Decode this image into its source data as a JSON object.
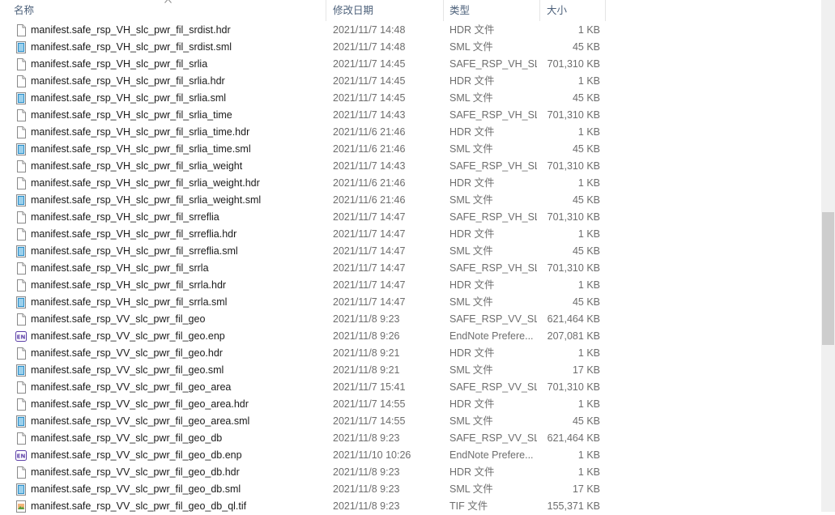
{
  "columns": {
    "name": "名称",
    "date": "修改日期",
    "type": "类型",
    "size": "大小"
  },
  "rows": [
    {
      "name": "manifest.safe_rsp_VH_slc_pwr_fil_srdist.hdr",
      "date": "2021/11/7 14:48",
      "type": "HDR 文件",
      "size": "1 KB",
      "icon": "document-icon"
    },
    {
      "name": "manifest.safe_rsp_VH_slc_pwr_fil_srdist.sml",
      "date": "2021/11/7 14:48",
      "type": "SML 文件",
      "size": "45 KB",
      "icon": "sml-file-icon"
    },
    {
      "name": "manifest.safe_rsp_VH_slc_pwr_fil_srlia",
      "date": "2021/11/7 14:45",
      "type": "SAFE_RSP_VH_SL...",
      "size": "701,310 KB",
      "icon": "document-icon"
    },
    {
      "name": "manifest.safe_rsp_VH_slc_pwr_fil_srlia.hdr",
      "date": "2021/11/7 14:45",
      "type": "HDR 文件",
      "size": "1 KB",
      "icon": "document-icon"
    },
    {
      "name": "manifest.safe_rsp_VH_slc_pwr_fil_srlia.sml",
      "date": "2021/11/7 14:45",
      "type": "SML 文件",
      "size": "45 KB",
      "icon": "sml-file-icon"
    },
    {
      "name": "manifest.safe_rsp_VH_slc_pwr_fil_srlia_time",
      "date": "2021/11/7 14:43",
      "type": "SAFE_RSP_VH_SL...",
      "size": "701,310 KB",
      "icon": "document-icon"
    },
    {
      "name": "manifest.safe_rsp_VH_slc_pwr_fil_srlia_time.hdr",
      "date": "2021/11/6 21:46",
      "type": "HDR 文件",
      "size": "1 KB",
      "icon": "document-icon"
    },
    {
      "name": "manifest.safe_rsp_VH_slc_pwr_fil_srlia_time.sml",
      "date": "2021/11/6 21:46",
      "type": "SML 文件",
      "size": "45 KB",
      "icon": "sml-file-icon"
    },
    {
      "name": "manifest.safe_rsp_VH_slc_pwr_fil_srlia_weight",
      "date": "2021/11/7 14:43",
      "type": "SAFE_RSP_VH_SL...",
      "size": "701,310 KB",
      "icon": "document-icon"
    },
    {
      "name": "manifest.safe_rsp_VH_slc_pwr_fil_srlia_weight.hdr",
      "date": "2021/11/6 21:46",
      "type": "HDR 文件",
      "size": "1 KB",
      "icon": "document-icon"
    },
    {
      "name": "manifest.safe_rsp_VH_slc_pwr_fil_srlia_weight.sml",
      "date": "2021/11/6 21:46",
      "type": "SML 文件",
      "size": "45 KB",
      "icon": "sml-file-icon"
    },
    {
      "name": "manifest.safe_rsp_VH_slc_pwr_fil_srreflia",
      "date": "2021/11/7 14:47",
      "type": "SAFE_RSP_VH_SL...",
      "size": "701,310 KB",
      "icon": "document-icon"
    },
    {
      "name": "manifest.safe_rsp_VH_slc_pwr_fil_srreflia.hdr",
      "date": "2021/11/7 14:47",
      "type": "HDR 文件",
      "size": "1 KB",
      "icon": "document-icon"
    },
    {
      "name": "manifest.safe_rsp_VH_slc_pwr_fil_srreflia.sml",
      "date": "2021/11/7 14:47",
      "type": "SML 文件",
      "size": "45 KB",
      "icon": "sml-file-icon"
    },
    {
      "name": "manifest.safe_rsp_VH_slc_pwr_fil_srrla",
      "date": "2021/11/7 14:47",
      "type": "SAFE_RSP_VH_SL...",
      "size": "701,310 KB",
      "icon": "document-icon"
    },
    {
      "name": "manifest.safe_rsp_VH_slc_pwr_fil_srrla.hdr",
      "date": "2021/11/7 14:47",
      "type": "HDR 文件",
      "size": "1 KB",
      "icon": "document-icon"
    },
    {
      "name": "manifest.safe_rsp_VH_slc_pwr_fil_srrla.sml",
      "date": "2021/11/7 14:47",
      "type": "SML 文件",
      "size": "45 KB",
      "icon": "sml-file-icon"
    },
    {
      "name": "manifest.safe_rsp_VV_slc_pwr_fil_geo",
      "date": "2021/11/8 9:23",
      "type": "SAFE_RSP_VV_SL...",
      "size": "621,464 KB",
      "icon": "document-icon"
    },
    {
      "name": "manifest.safe_rsp_VV_slc_pwr_fil_geo.enp",
      "date": "2021/11/8 9:26",
      "type": "EndNote Prefere...",
      "size": "207,081 KB",
      "icon": "endnote-icon"
    },
    {
      "name": "manifest.safe_rsp_VV_slc_pwr_fil_geo.hdr",
      "date": "2021/11/8 9:21",
      "type": "HDR 文件",
      "size": "1 KB",
      "icon": "document-icon"
    },
    {
      "name": "manifest.safe_rsp_VV_slc_pwr_fil_geo.sml",
      "date": "2021/11/8 9:21",
      "type": "SML 文件",
      "size": "17 KB",
      "icon": "sml-file-icon"
    },
    {
      "name": "manifest.safe_rsp_VV_slc_pwr_fil_geo_area",
      "date": "2021/11/7 15:41",
      "type": "SAFE_RSP_VV_SL...",
      "size": "701,310 KB",
      "icon": "document-icon"
    },
    {
      "name": "manifest.safe_rsp_VV_slc_pwr_fil_geo_area.hdr",
      "date": "2021/11/7 14:55",
      "type": "HDR 文件",
      "size": "1 KB",
      "icon": "document-icon"
    },
    {
      "name": "manifest.safe_rsp_VV_slc_pwr_fil_geo_area.sml",
      "date": "2021/11/7 14:55",
      "type": "SML 文件",
      "size": "45 KB",
      "icon": "sml-file-icon"
    },
    {
      "name": "manifest.safe_rsp_VV_slc_pwr_fil_geo_db",
      "date": "2021/11/8 9:23",
      "type": "SAFE_RSP_VV_SL...",
      "size": "621,464 KB",
      "icon": "document-icon"
    },
    {
      "name": "manifest.safe_rsp_VV_slc_pwr_fil_geo_db.enp",
      "date": "2021/11/10 10:26",
      "type": "EndNote Prefere...",
      "size": "1 KB",
      "icon": "endnote-icon"
    },
    {
      "name": "manifest.safe_rsp_VV_slc_pwr_fil_geo_db.hdr",
      "date": "2021/11/8 9:23",
      "type": "HDR 文件",
      "size": "1 KB",
      "icon": "document-icon"
    },
    {
      "name": "manifest.safe_rsp_VV_slc_pwr_fil_geo_db.sml",
      "date": "2021/11/8 9:23",
      "type": "SML 文件",
      "size": "17 KB",
      "icon": "sml-file-icon"
    },
    {
      "name": "manifest.safe_rsp_VV_slc_pwr_fil_geo_db_ql.tif",
      "date": "2021/11/8 9:23",
      "type": "TIF 文件",
      "size": "155,371 KB",
      "icon": "image-file-icon"
    }
  ],
  "colors": {
    "header_text": "#4c607a",
    "meta_text": "#6d6d6d",
    "name_text": "#1a1a1a",
    "scrollbar_track": "#f0f0f0",
    "scrollbar_thumb": "#cdcdcd",
    "endnote_badge": "#5c3fa8",
    "sml_icon": "#2c8fc9"
  },
  "scroll": {
    "thumb_fraction_start": 0.41,
    "thumb_fraction_size": 0.26
  }
}
